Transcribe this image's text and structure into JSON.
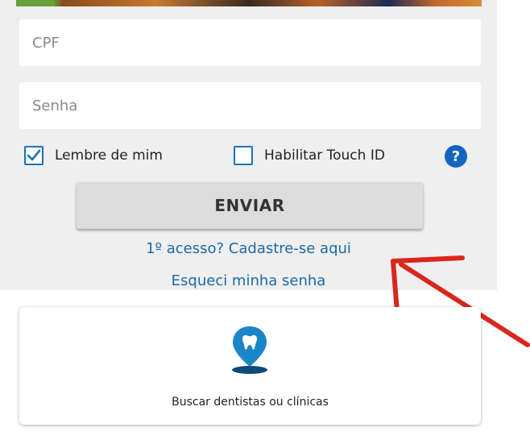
{
  "login": {
    "cpf_placeholder": "CPF",
    "password_placeholder": "Senha",
    "remember_me_label": "Lembre de mim",
    "remember_me_checked": true,
    "touch_id_label": "Habilitar Touch ID",
    "touch_id_checked": false,
    "help_icon": "?",
    "submit_label": "ENVIAR",
    "register_link": "1º acesso? Cadastre-se aqui",
    "forgot_password_link": "Esqueci minha senha"
  },
  "search_card": {
    "icon": "tooth-location-pin-icon",
    "label": "Buscar dentistas ou clínicas"
  },
  "colors": {
    "accent_blue": "#1a73b8",
    "link_blue": "#1a6aa8",
    "arrow_red": "#d9271e",
    "panel_bg": "#efefef"
  }
}
